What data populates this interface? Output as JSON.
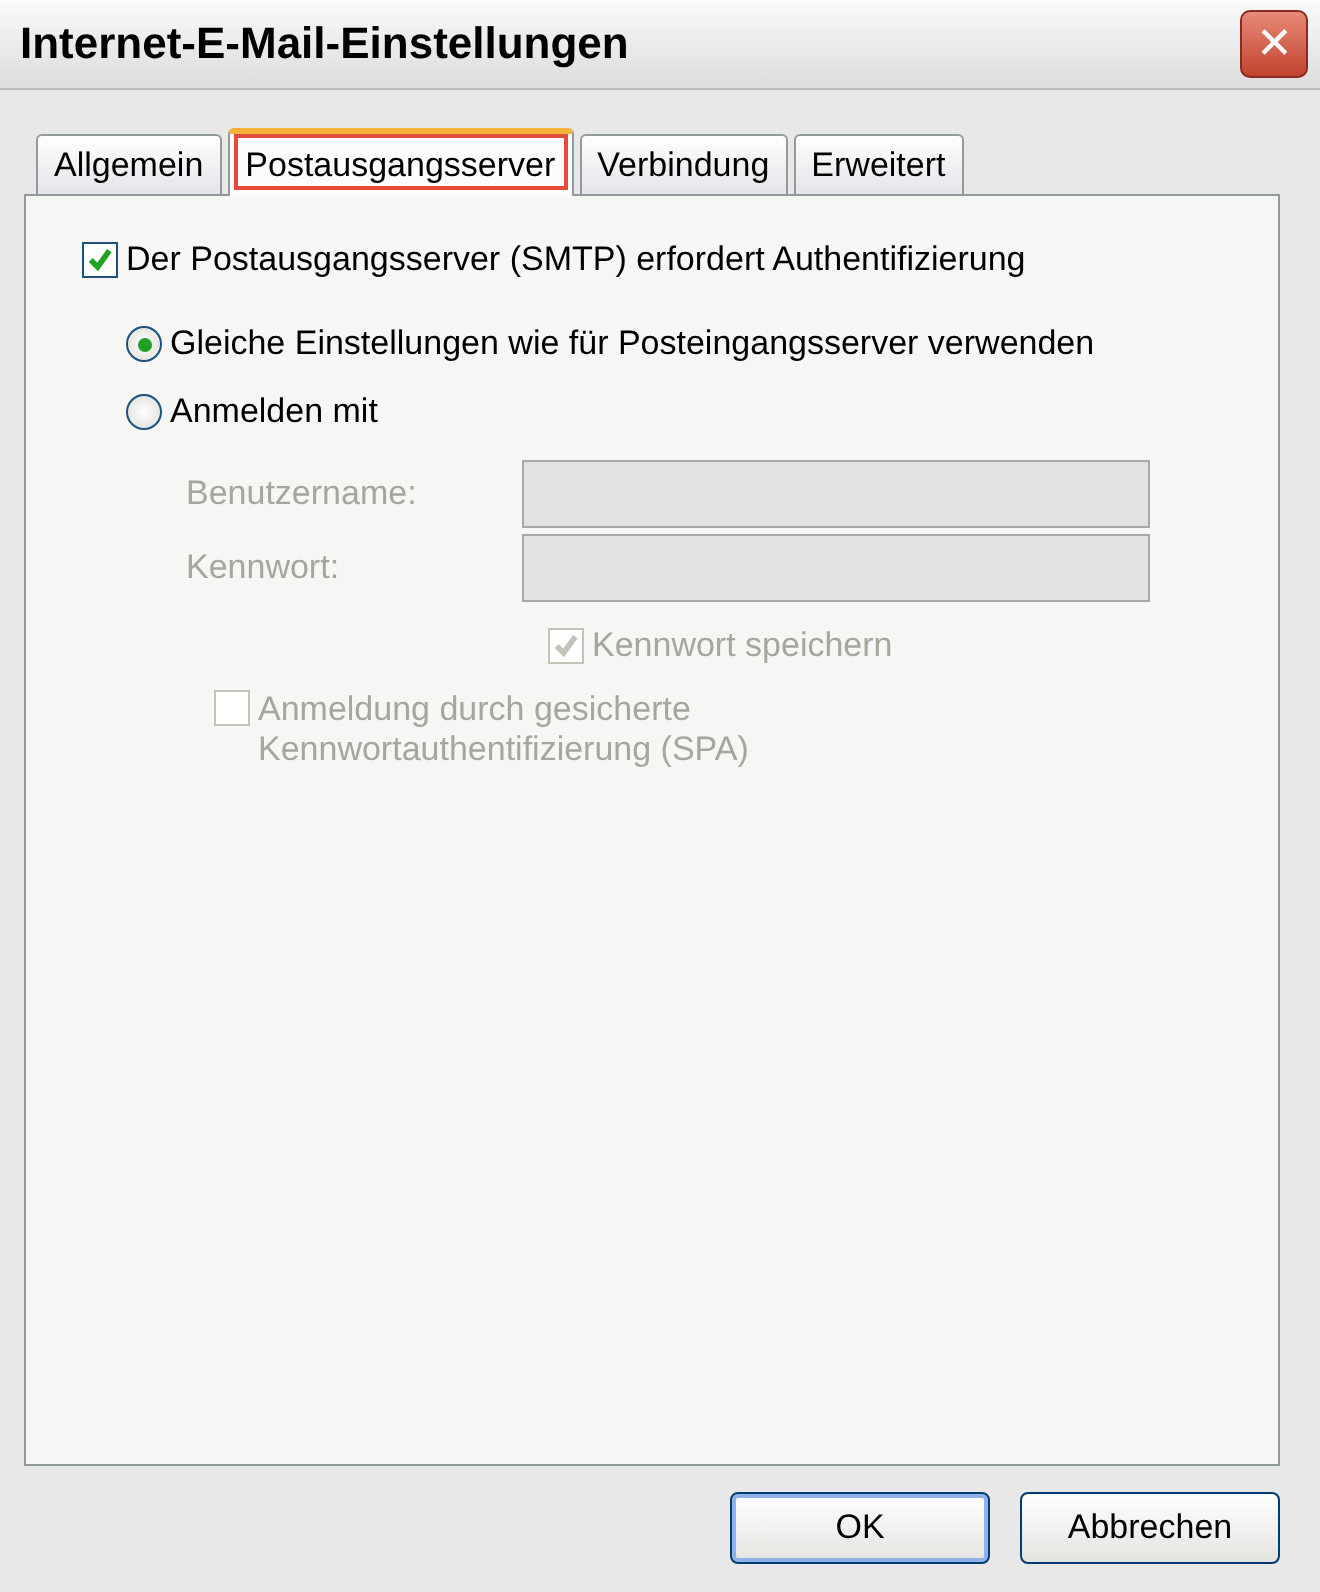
{
  "window": {
    "title": "Internet-E-Mail-Einstellungen",
    "close": "✕"
  },
  "tabs": [
    {
      "label": "Allgemein",
      "selected": false
    },
    {
      "label": "Postausgangsserver",
      "selected": true
    },
    {
      "label": "Verbindung",
      "selected": false
    },
    {
      "label": "Erweitert",
      "selected": false
    }
  ],
  "auth_checkbox": {
    "label": "Der Postausgangsserver (SMTP) erfordert Authentifizierung",
    "checked": true
  },
  "radios": [
    {
      "label": "Gleiche Einstellungen wie für Posteingangsserver verwenden",
      "selected": true
    },
    {
      "label": "Anmelden mit",
      "selected": false
    }
  ],
  "fields": [
    {
      "label": "Benutzername:",
      "disabled": true
    },
    {
      "label": "Kennwort:",
      "disabled": true
    }
  ],
  "options": [
    {
      "label": "Kennwort speichern",
      "checked": true,
      "disabled": true
    },
    {
      "label": "Anmeldung durch gesicherte Kennwortauthentifizierung (SPA)",
      "checked": false,
      "disabled": true
    }
  ],
  "buttons": [
    {
      "label": "OK",
      "default": true
    },
    {
      "label": "Abbrechen",
      "default": false
    }
  ]
}
